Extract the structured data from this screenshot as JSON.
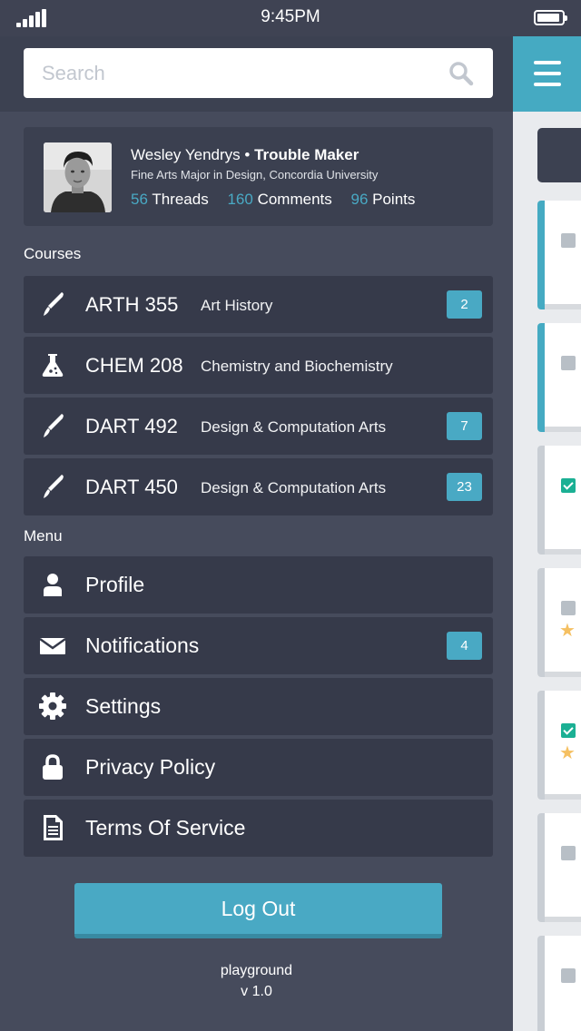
{
  "status_bar": {
    "time": "9:45PM"
  },
  "search": {
    "placeholder": "Search"
  },
  "profile": {
    "name": "Wesley Yendrys",
    "role": "Trouble Maker",
    "description": "Fine Arts Major in Design, Concordia University",
    "stats": [
      {
        "value": "56",
        "label": "Threads"
      },
      {
        "value": "160",
        "label": "Comments"
      },
      {
        "value": "96",
        "label": "Points"
      }
    ]
  },
  "courses": {
    "heading": "Courses",
    "items": [
      {
        "code": "ARTH 355",
        "title": "Art History",
        "badge": "2",
        "icon": "brush-icon"
      },
      {
        "code": "CHEM 208",
        "title": "Chemistry and Biochemistry",
        "badge": "",
        "icon": "flask-icon"
      },
      {
        "code": "DART 492",
        "title": "Design & Computation Arts",
        "badge": "7",
        "icon": "brush-icon"
      },
      {
        "code": "DART 450",
        "title": "Design & Computation Arts",
        "badge": "23",
        "icon": "brush-icon"
      }
    ]
  },
  "menu": {
    "heading": "Menu",
    "items": [
      {
        "label": "Profile",
        "badge": "",
        "icon": "user-icon"
      },
      {
        "label": "Notifications",
        "badge": "4",
        "icon": "envelope-icon"
      },
      {
        "label": "Settings",
        "badge": "",
        "icon": "gear-icon"
      },
      {
        "label": "Privacy Policy",
        "badge": "",
        "icon": "lock-icon"
      },
      {
        "label": "Terms Of Service",
        "badge": "",
        "icon": "document-icon"
      }
    ]
  },
  "logout_label": "Log Out",
  "footer": {
    "app_name": "playground",
    "version": "v 1.0"
  },
  "colors": {
    "accent": "#49a9c4",
    "drawer_bg": "#464b5c",
    "row_bg": "#363a4a",
    "check_green": "#1bb094",
    "star": "#f5c062"
  }
}
